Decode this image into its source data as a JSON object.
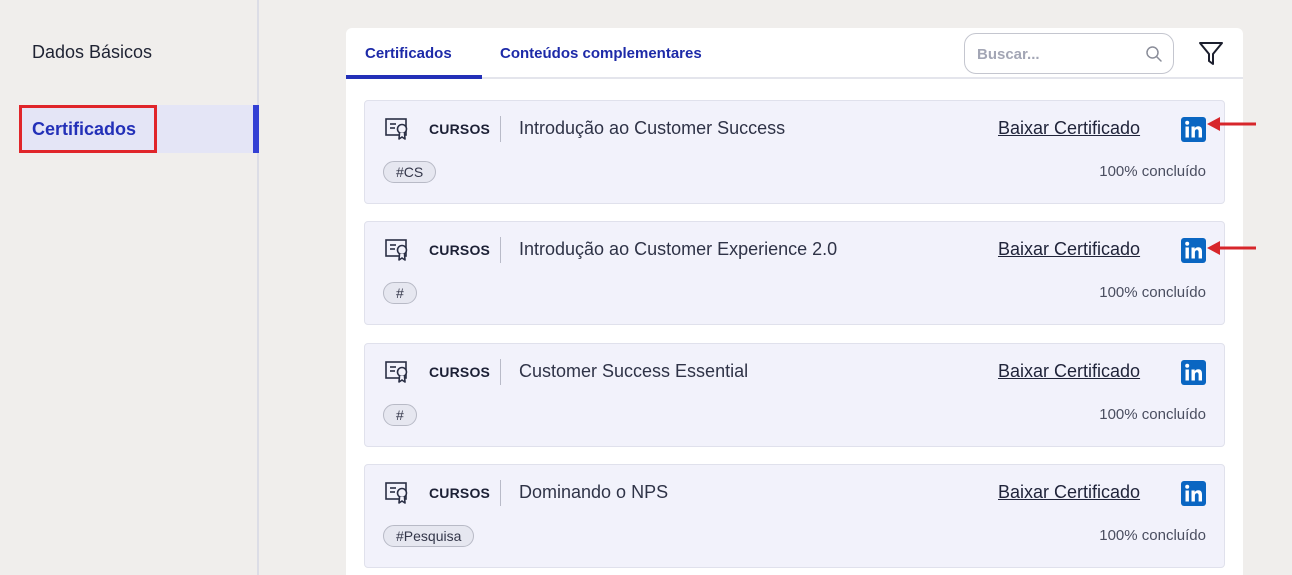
{
  "sidebar": {
    "items": [
      {
        "label": "Dados Básicos"
      },
      {
        "label": "Certificados"
      }
    ]
  },
  "tabs": [
    {
      "label": "Certificados"
    },
    {
      "label": "Conteúdos complementares"
    }
  ],
  "search": {
    "placeholder": "Buscar..."
  },
  "cards": [
    {
      "type": "CURSOS",
      "title": "Introdução ao Customer Success",
      "download": "Baixar Certificado",
      "tag": "#CS",
      "progress": "100% concluído"
    },
    {
      "type": "CURSOS",
      "title": "Introdução ao Customer Experience 2.0",
      "download": "Baixar Certificado",
      "tag": "#",
      "progress": "100% concluído"
    },
    {
      "type": "CURSOS",
      "title": "Customer Success Essential",
      "download": "Baixar Certificado",
      "tag": "#",
      "progress": "100% concluído"
    },
    {
      "type": "CURSOS",
      "title": "Dominando o NPS",
      "download": "Baixar Certificado",
      "tag": "#Pesquisa",
      "progress": "100% concluído"
    }
  ],
  "icons": {
    "certificate": "certificate-icon",
    "linkedin": "linkedin-icon",
    "search": "search-icon",
    "filter": "filter-icon",
    "annotation": "arrow-left-icon"
  },
  "colors": {
    "accent": "#2330b8",
    "linkedin": "#0a66c2",
    "highlight_box": "#e0252a",
    "annotation_arrow": "#d7262b"
  }
}
